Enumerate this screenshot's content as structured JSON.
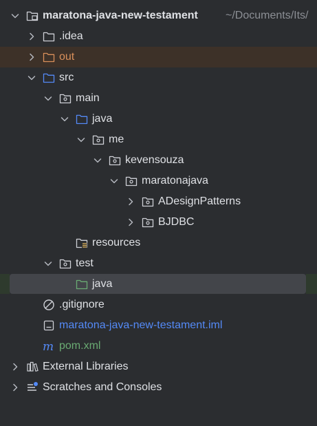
{
  "project": {
    "name": "maratona-java-new-testament",
    "path_hint": "~/Documents/Its/"
  },
  "tree": {
    "idea": ".idea",
    "out": "out",
    "src": "src",
    "main": "main",
    "java_main": "java",
    "me": "me",
    "kevensouza": "kevensouza",
    "maratonajava": "maratonajava",
    "adesign": "ADesignPatterns",
    "bjdbc": "BJDBC",
    "resources": "resources",
    "test": "test",
    "java_test": "java",
    "gitignore": ".gitignore",
    "iml": "maratona-java-new-testament.iml",
    "pom": "pom.xml",
    "external_libraries": "External Libraries",
    "scratches": "Scratches and Consoles"
  },
  "colors": {
    "background": "#2b2d30",
    "selection": "#43454a",
    "excluded_row": "#3d3128",
    "excluded_text": "#d98f5a",
    "module_file_text": "#548af7",
    "maven_text": "#6aab73",
    "source_folder": "#548af7",
    "test_folder": "#6aab73"
  }
}
